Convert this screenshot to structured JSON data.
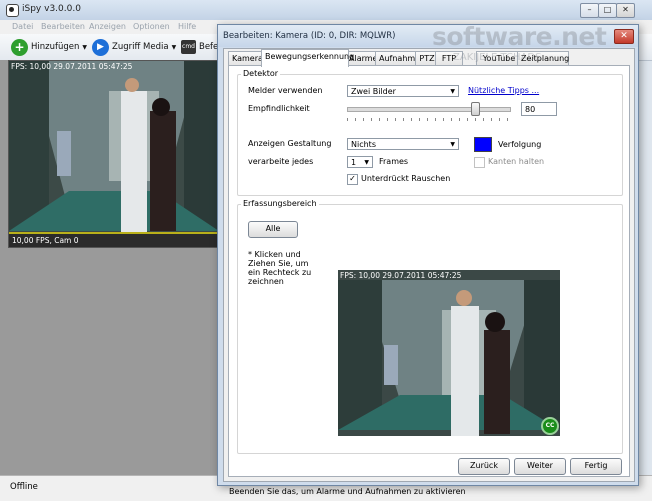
{
  "main_window": {
    "title": "iSpy v3.0.0.0",
    "controls": {
      "minimize": "–",
      "maximize": "□",
      "close": "✕"
    }
  },
  "menu": [
    "Datei",
    "Bearbeiten",
    "Anzeigen",
    "Optionen",
    "Hilfe"
  ],
  "toolbar": {
    "add": "Hinzufügen",
    "remote": "Zugriff Media",
    "cmd": "Befe"
  },
  "left_camera": {
    "overlay": "FPS: 10,00 29.07.2011 05:47:25",
    "status": "10,00 FPS, Cam 0"
  },
  "statusbar": {
    "text": "Offline"
  },
  "watermark": {
    "line1": "software.net",
    "line2": "ZAKIJELE TCHADS"
  },
  "dialog": {
    "title": "Bearbeiten: Kamera (ID: 0, DIR: MQLWR)",
    "close": "✕",
    "tabs": [
      "Kamera",
      "Bewegungserkennung",
      "Alarme",
      "Aufnahme",
      "PTZ",
      "FTP",
      "YouTube",
      "Zeitplanung"
    ],
    "active_tab": "Bewegungserkennung",
    "detector": {
      "group_label": "Detektor",
      "melder_label": "Melder verwenden",
      "melder_value": "Zwei Bilder",
      "tips_link": "Nützliche Tipps ...",
      "sensitivity_label": "Empfindlichkeit",
      "sensitivity_value": "80",
      "sensitivity_level": 0.8,
      "display_label": "Anzeigen Gestaltung",
      "display_value": "Nichts",
      "tracking_label": "Verfolgung",
      "tracking_color": "#0000ff",
      "process_label": "verarbeite jedes",
      "process_value": "1",
      "frames_label": "Frames",
      "edges_label": "Kanten halten",
      "edges_checked": false,
      "noise_label": "Unterdrückt Rauschen",
      "noise_checked": true
    },
    "area": {
      "group_label": "Erfassungsbereich",
      "all_button": "Alle",
      "hint": "* Klicken und Ziehen Sie, um ein Rechteck zu zeichnen",
      "preview_overlay": "FPS: 10,00 29.07.2011 05:47:25",
      "badge": "CC"
    },
    "footer": {
      "text": "Beenden Sie das, um Alarme und Aufnahmen zu aktivieren",
      "back": "Zurück",
      "next": "Weiter",
      "finish": "Fertig"
    }
  },
  "colors": {
    "add_green": "#2e9e2e",
    "remote_blue": "#1d6fd8",
    "tracking_blue": "#0000ff"
  }
}
